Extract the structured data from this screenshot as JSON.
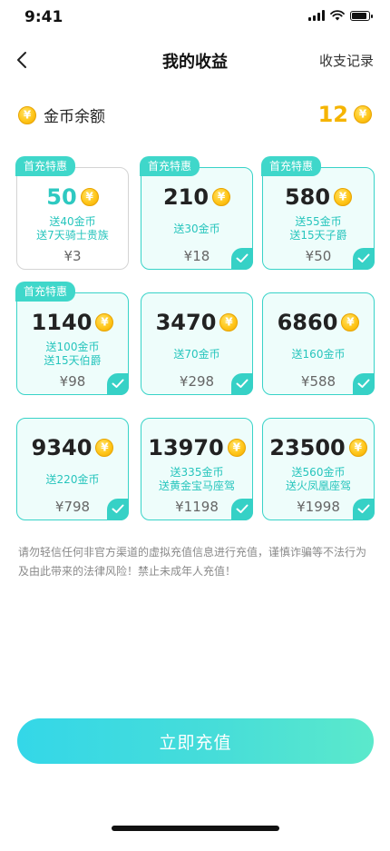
{
  "status_bar": {
    "time": "9:41"
  },
  "nav": {
    "title": "我的收益",
    "record_label": "收支记录",
    "back_icon": "chevron-left-icon"
  },
  "balance": {
    "label": "金币余额",
    "amount": "12",
    "icon": "coin-icon"
  },
  "packages": [
    {
      "coins": "50",
      "gift": [
        "送40金币",
        "送7天骑士贵族"
      ],
      "price": "¥3",
      "badge": "首充特惠",
      "selected": false
    },
    {
      "coins": "210",
      "gift": [
        "送30金币"
      ],
      "price": "¥18",
      "badge": "首充特惠",
      "selected": true
    },
    {
      "coins": "580",
      "gift": [
        "送55金币",
        "送15天子爵"
      ],
      "price": "¥50",
      "badge": "首充特惠",
      "selected": true
    },
    {
      "coins": "1140",
      "gift": [
        "送100金币",
        "送15天伯爵"
      ],
      "price": "¥98",
      "badge": "首充特惠",
      "selected": true
    },
    {
      "coins": "3470",
      "gift": [
        "送70金币"
      ],
      "price": "¥298",
      "badge": "",
      "selected": true
    },
    {
      "coins": "6860",
      "gift": [
        "送160金币"
      ],
      "price": "¥588",
      "badge": "",
      "selected": true
    },
    {
      "coins": "9340",
      "gift": [
        "送220金币"
      ],
      "price": "¥798",
      "badge": "",
      "selected": true
    },
    {
      "coins": "13970",
      "gift": [
        "送335金币",
        "送黄金宝马座驾"
      ],
      "price": "¥1198",
      "badge": "",
      "selected": true
    },
    {
      "coins": "23500",
      "gift": [
        "送560金币",
        "送火凤凰座驾"
      ],
      "price": "¥1998",
      "badge": "",
      "selected": true
    }
  ],
  "notice": "请勿轻信任何非官方渠道的虚拟充值信息进行充值，谨慎诈骗等不法行为及由此带来的法律风险！禁止未成年人充值！",
  "button": {
    "label": "立即充值"
  },
  "colors": {
    "accent": "#38d3c8",
    "coin": "#f5b400",
    "button_start": "#34d7e8",
    "button_end": "#5be9cb"
  }
}
